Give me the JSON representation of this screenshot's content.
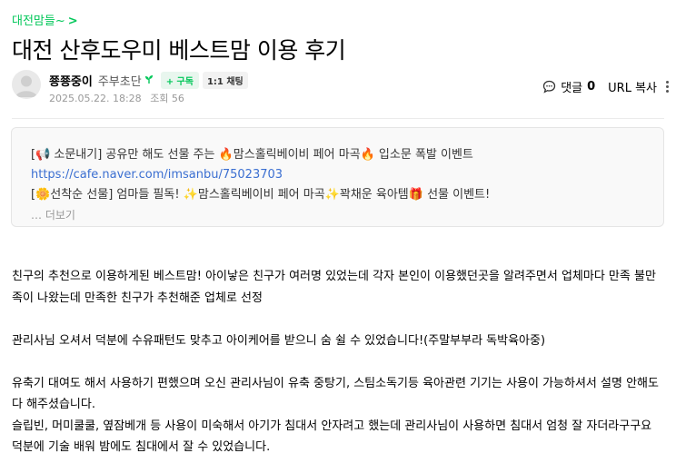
{
  "header": {
    "cafe_name": "대전맘들~",
    "cafe_chevron": ">",
    "title": "대전 산후도우미 베스트맘 이용 후기"
  },
  "author": {
    "nickname": "쭁쭁중이",
    "rank": "주부초단",
    "rank_icon": "sprout-icon",
    "follow_label": "+ 구독",
    "chat_label": "1:1 채팅",
    "date": "2025.05.22. 18:28",
    "views_label": "조회 56"
  },
  "actions": {
    "comment_label": "댓글",
    "comment_count": "0",
    "url_copy_label": "URL 복사"
  },
  "notice": {
    "line1": "[📢 소문내기] 공유만 해도 선물 주는 🔥맘스홀릭베이비 페어 마곡🔥 입소문 폭발 이벤트",
    "link": "https://cafe.naver.com/imsanbu/75023703",
    "line3": "[🌼선착순 선물] 엄마들 필독! ✨맘스홀릭베이비 페어 마곡✨꽉채운 육아템🎁 선물 이벤트!",
    "more_label": "… 더보기"
  },
  "body": {
    "p1": "친구의 추천으로 이용하게된 베스트맘! 아이낳은 친구가 여러명 있었는데 각자 본인이 이용했던곳을 알려주면서 업체마다 만족 불만족이 나왔는데 만족한 친구가 추천해준 업체로 선정",
    "p2": "관리사님 오셔서 덕분에 수유패턴도 맞추고 아이케어를 받으니 숨 쉴 수 있었습니다!(주말부부라 독박육아중)",
    "p3": "유축기 대여도 해서 사용하기 편했으며 오신 관리사님이 유축 중탕기, 스팀소독기등 육아관련 기기는 사용이 가능하셔서 설명 안해도 다 해주셨습니다.",
    "p4": "슬립빈, 머미쿨쿨, 옆잠베개 등 사용이 미숙해서 아기가 침대서 안자려고 했는데 관리사님이 사용하면 침대서 엄청 잘 자더라구구요 덕분에 기술 배워 밤에도 침대에서 잘 수 있었습니다."
  },
  "colors": {
    "brand_green": "#03c75a",
    "link_blue": "#3b6fd1",
    "notice_bg": "#f9f9f9"
  }
}
